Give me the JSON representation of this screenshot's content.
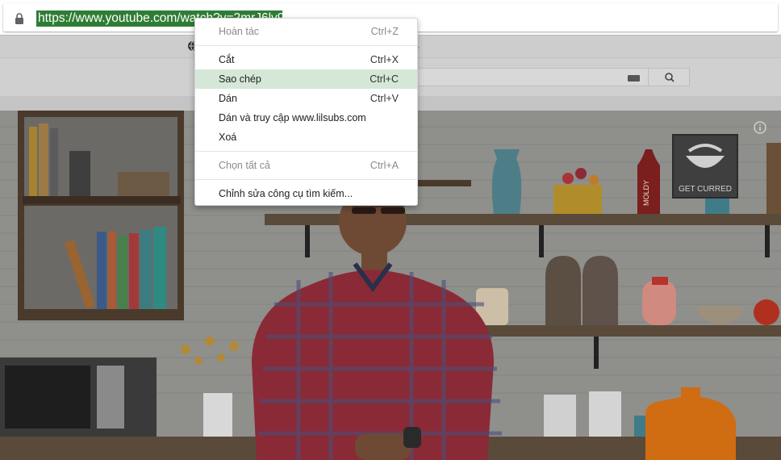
{
  "browser": {
    "url": "https://www.youtube.com/watch?v=2mrJ6lv9StQ"
  },
  "context_menu": {
    "items": [
      {
        "label": "Hoàn tác",
        "shortcut": "Ctrl+Z",
        "disabled": true
      },
      {
        "label": "Cắt",
        "shortcut": "Ctrl+X"
      },
      {
        "label": "Sao chép",
        "shortcut": "Ctrl+C",
        "highlighted": true
      },
      {
        "label": "Dán",
        "shortcut": "Ctrl+V"
      },
      {
        "label": "Dán và truy cập www.lilsubs.com",
        "shortcut": ""
      },
      {
        "label": "Xoá",
        "shortcut": ""
      },
      {
        "label": "Chọn tất cả",
        "shortcut": "Ctrl+A",
        "disabled": true
      },
      {
        "label": "Chỉnh sửa công cụ tìm kiếm...",
        "shortcut": ""
      }
    ]
  },
  "video": {
    "logo_text": "GET CURRED",
    "bottle_text": "MOLDY"
  },
  "colors": {
    "selection": "#2f7d35",
    "menu_highlight": "#d5e7d6"
  }
}
